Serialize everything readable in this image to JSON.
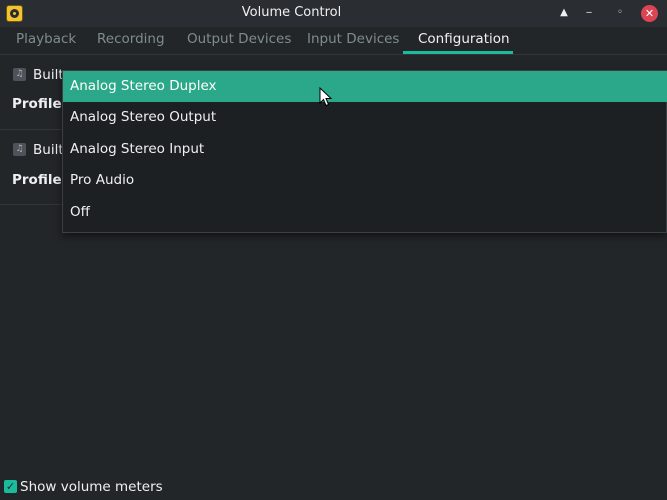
{
  "window": {
    "title": "Volume Control",
    "shade_icon": "▲",
    "minimize_icon": "‒",
    "maximize_icon": "◦",
    "close_icon": "✕"
  },
  "tabs": [
    {
      "label": "Playback"
    },
    {
      "label": "Recording"
    },
    {
      "label": "Output Devices"
    },
    {
      "label": "Input Devices"
    },
    {
      "label": "Configuration",
      "active": true
    }
  ],
  "cards": [
    {
      "name": "Built-",
      "profile_label": "Profile:",
      "icon": "♫"
    },
    {
      "name": "Built-",
      "profile_label": "Profile:",
      "icon": "♫"
    }
  ],
  "dropdown": {
    "selected": "Analog Stereo Duplex",
    "options": [
      "Analog Stereo Duplex",
      "Analog Stereo Output",
      "Analog Stereo Input",
      "Pro Audio",
      "Off"
    ]
  },
  "footer": {
    "show_meters_label": "Show volume meters",
    "show_meters_checked": true,
    "check_glyph": "✓"
  },
  "colors": {
    "accent": "#1abc9c",
    "selected_row": "#2ba889",
    "close": "#da4453",
    "background": "#232629"
  }
}
